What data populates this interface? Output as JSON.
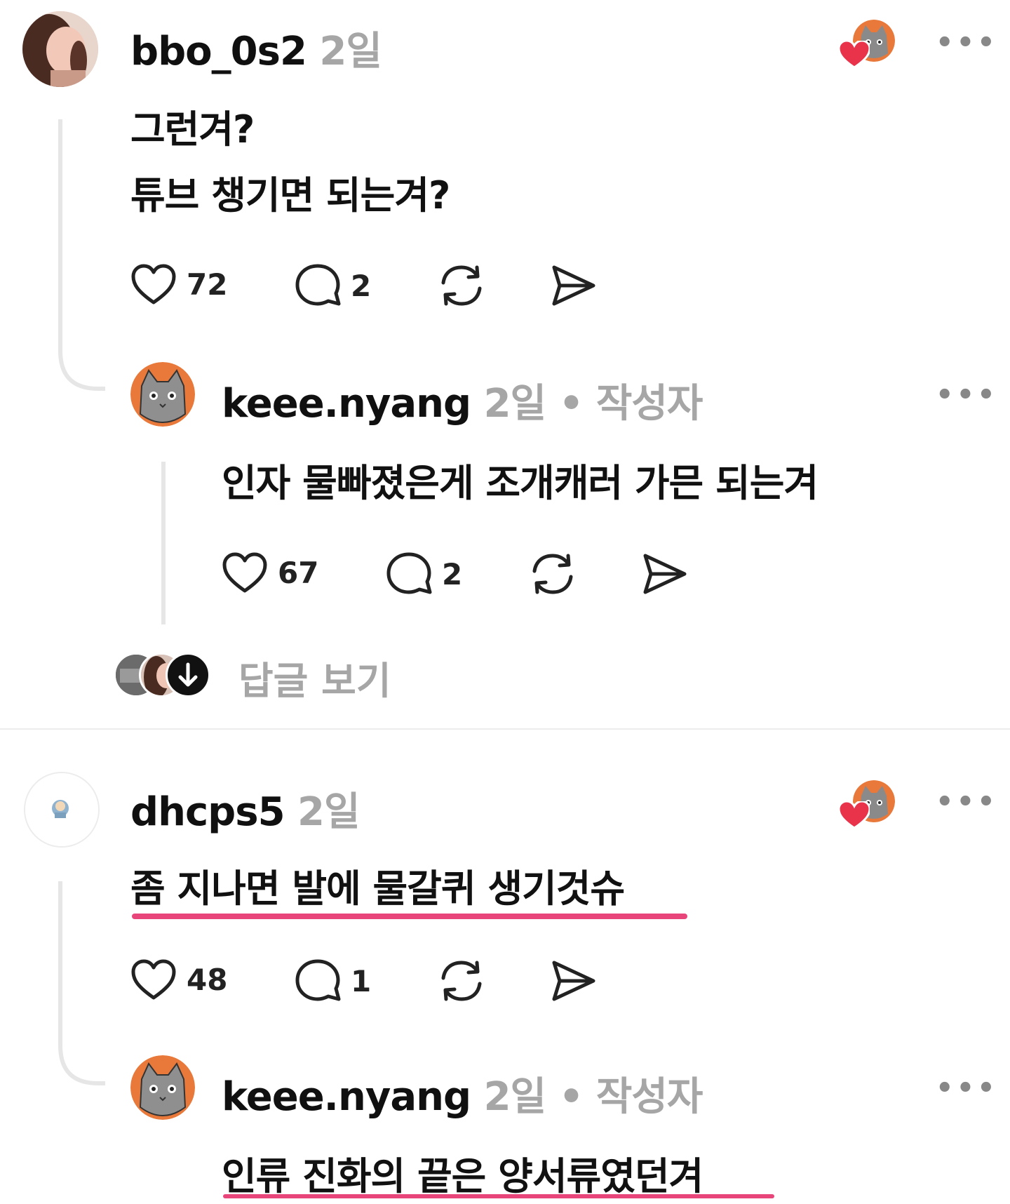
{
  "comments": [
    {
      "username": "bbo_0s2",
      "time": "2일",
      "lines": [
        "그런겨?",
        "튜브 챙기면 되는겨?"
      ],
      "likes": "72",
      "replies": "2"
    },
    {
      "username": "keee.nyang",
      "time": "2일",
      "author_tag": "• 작성자",
      "lines": [
        "인자 물빠졌은게 조개캐러 가믄 되는겨"
      ],
      "likes": "67",
      "replies": "2"
    },
    {
      "username": "dhcps5",
      "time": "2일",
      "lines": [
        "좀 지나면 발에 물갈퀴 생기것슈"
      ],
      "likes": "48",
      "replies": "1"
    },
    {
      "username": "keee.nyang",
      "time": "2일",
      "author_tag": "• 작성자",
      "lines": [
        "인류 진화의 끝은 양서류였던겨"
      ]
    }
  ],
  "view_replies_label": "답글 보기",
  "more_label": "•••",
  "colors": {
    "highlight": "#e8457a",
    "heart": "#e8334a",
    "cat_orange": "#e8793a"
  }
}
